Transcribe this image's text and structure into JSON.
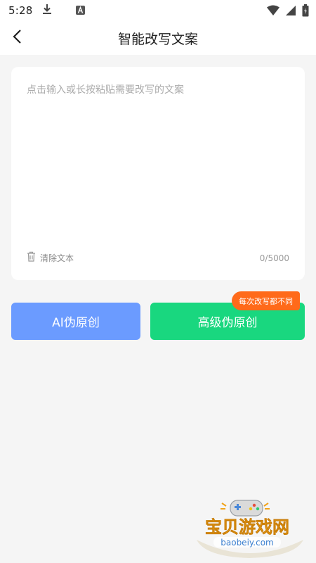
{
  "status_bar": {
    "time": "5:28",
    "icons": [
      "download-icon",
      "accessibility-icon",
      "wifi-icon",
      "signal-icon",
      "battery-icon"
    ]
  },
  "header": {
    "title": "智能改写文案",
    "back_icon": "back-arrow-icon"
  },
  "editor": {
    "placeholder": "点击输入或长按粘贴需要改写的文案",
    "value": "",
    "clear_label": "清除文本",
    "char_count": "0/5000"
  },
  "actions": {
    "ai_button_label": "AI伪原创",
    "advanced_button_label": "高级伪原创",
    "promo_badge": "每次改写都不同"
  },
  "watermark": {
    "title": "宝贝游戏网",
    "url": "baobeiy.com"
  },
  "colors": {
    "ai_button": "#6b9bff",
    "advanced_button": "#19d77f",
    "promo_badge": "#ff6a1a",
    "page_background": "#f5f5f5"
  }
}
